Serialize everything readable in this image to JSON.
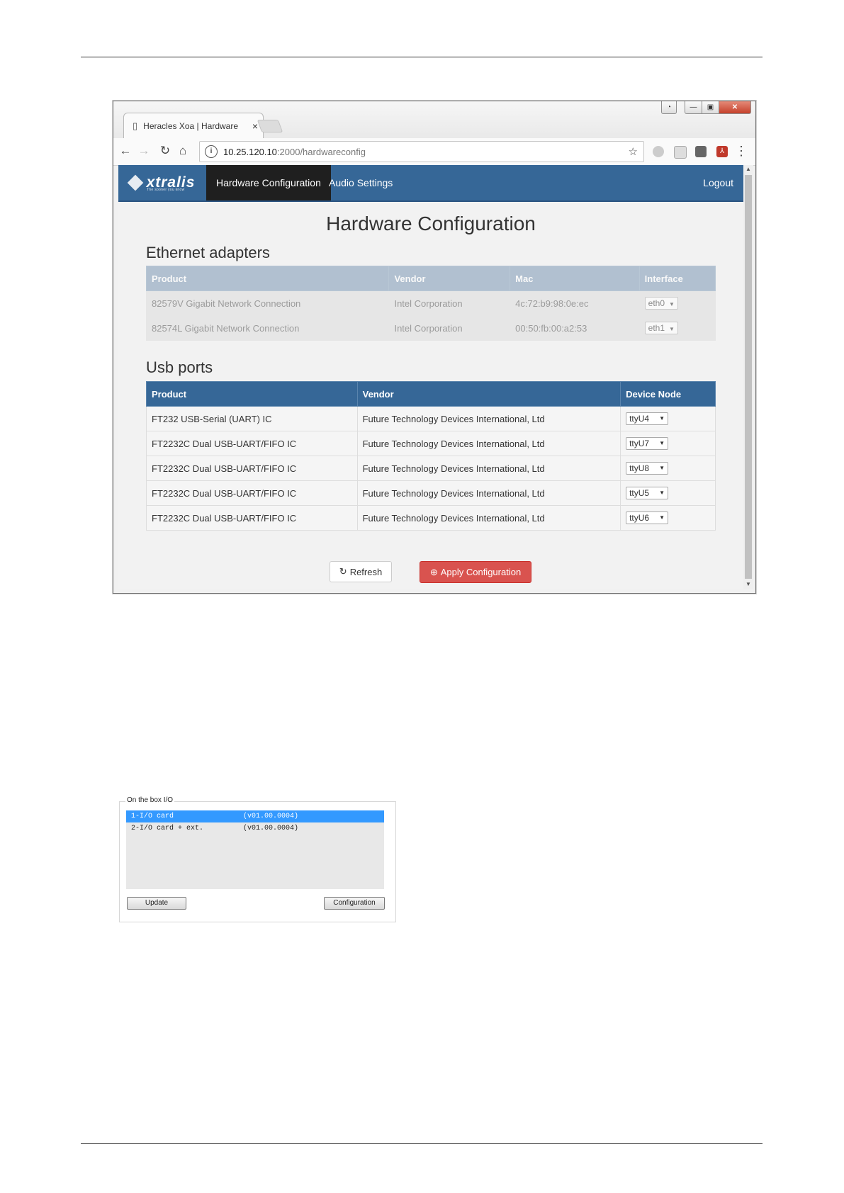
{
  "browser": {
    "tab_title": "Heracles Xoa | Hardware",
    "tab_close": "×",
    "url_host": "10.25.120.10",
    "url_rest": ":2000/hardwareconfig"
  },
  "app": {
    "brand": "xtralis",
    "brand_tagline": "The sooner you know",
    "nav": {
      "hardware": "Hardware Configuration",
      "audio": "Audio Settings",
      "logout": "Logout"
    },
    "page_title": "Hardware Configuration",
    "ethernet": {
      "title": "Ethernet adapters",
      "headers": [
        "Product",
        "Vendor",
        "Mac",
        "Interface"
      ],
      "rows": [
        {
          "product": "82579V Gigabit Network Connection",
          "vendor": "Intel Corporation",
          "mac": "4c:72:b9:98:0e:ec",
          "interface": "eth0"
        },
        {
          "product": "82574L Gigabit Network Connection",
          "vendor": "Intel Corporation",
          "mac": "00:50:fb:00:a2:53",
          "interface": "eth1"
        }
      ]
    },
    "usb": {
      "title": "Usb ports",
      "headers": [
        "Product",
        "Vendor",
        "Device Node"
      ],
      "rows": [
        {
          "product": "FT232 USB-Serial (UART) IC",
          "vendor": "Future Technology Devices International, Ltd",
          "node": "ttyU4"
        },
        {
          "product": "FT2232C Dual USB-UART/FIFO IC",
          "vendor": "Future Technology Devices International, Ltd",
          "node": "ttyU7"
        },
        {
          "product": "FT2232C Dual USB-UART/FIFO IC",
          "vendor": "Future Technology Devices International, Ltd",
          "node": "ttyU8"
        },
        {
          "product": "FT2232C Dual USB-UART/FIFO IC",
          "vendor": "Future Technology Devices International, Ltd",
          "node": "ttyU5"
        },
        {
          "product": "FT2232C Dual USB-UART/FIFO IC",
          "vendor": "Future Technology Devices International, Ltd",
          "node": "ttyU6"
        }
      ]
    },
    "buttons": {
      "refresh": "Refresh",
      "apply": "Apply Configuration"
    }
  },
  "io_panel": {
    "legend": "On the box I/O",
    "items": [
      {
        "name": "1-I/O card",
        "version": "(v01.00.0004)"
      },
      {
        "name": "2-I/O card + ext.",
        "version": "(v01.00.0004)"
      }
    ],
    "update": "Update",
    "configuration": "Configuration"
  },
  "colors": {
    "nav_blue": "#366797",
    "danger": "#d9534f",
    "selection": "#3399ff"
  },
  "icons": [
    "document-icon",
    "close-icon",
    "back-arrow-icon",
    "forward-arrow-icon",
    "reload-icon",
    "home-icon",
    "info-icon",
    "star-icon",
    "menu-dots-icon",
    "refresh-icon",
    "apply-circle-icon"
  ]
}
